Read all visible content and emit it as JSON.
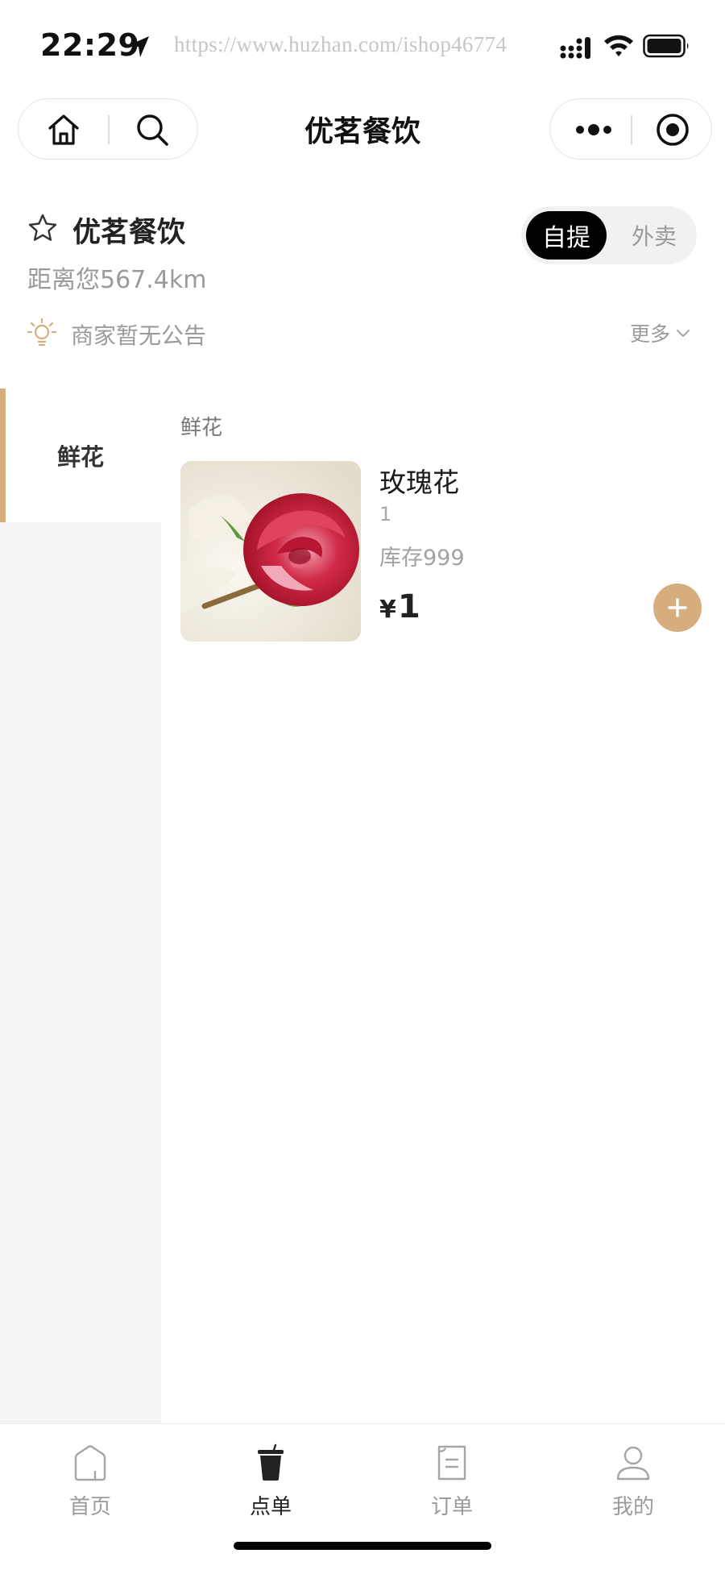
{
  "status_bar": {
    "time": "22:29",
    "watermark": "https://www.huzhan.com/ishop46774"
  },
  "nav": {
    "title": "优茗餐饮"
  },
  "shop": {
    "name": "优茗餐饮",
    "distance": "距离您567.4km",
    "mode_pickup": "自提",
    "mode_delivery": "外卖",
    "notice": "商家暂无公告",
    "more": "更多"
  },
  "sidebar": {
    "items": [
      {
        "label": "鲜花",
        "active": true
      }
    ]
  },
  "main": {
    "section_title": "鲜花",
    "products": [
      {
        "name": "玫瑰花",
        "desc": "1",
        "stock": "库存999",
        "price_symbol": "¥",
        "price": "1"
      }
    ]
  },
  "tab_bar": {
    "tabs": [
      {
        "label": "首页",
        "icon": "home-icon"
      },
      {
        "label": "点单",
        "icon": "cup-icon",
        "active": true
      },
      {
        "label": "订单",
        "icon": "order-icon"
      },
      {
        "label": "我的",
        "icon": "user-icon"
      }
    ]
  },
  "colors": {
    "accent": "#d6ad7d",
    "pickup_bg": "#000000",
    "sidebar_bg": "#f5f5f5"
  }
}
